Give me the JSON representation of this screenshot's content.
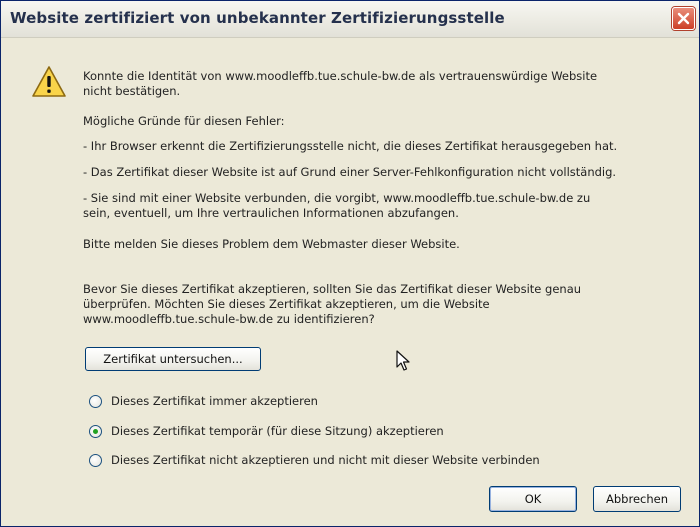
{
  "dialog": {
    "title": "Website zertifiziert von unbekannter Zertifizierungsstelle",
    "message": {
      "intro_line1": "Konnte die Identität von www.moodleffb.tue.schule-bw.de als vertrauenswürdige Website",
      "intro_line2": "nicht bestätigen.",
      "reasons_heading": "Mögliche Gründe für diesen Fehler:",
      "reason1": "- Ihr Browser erkennt die Zertifizierungsstelle nicht, die dieses Zertifikat herausgegeben hat.",
      "reason2": "- Das Zertifikat dieser Website ist auf Grund einer Server-Fehlkonfiguration nicht vollständig.",
      "reason3_line1": "- Sie sind mit einer Website verbunden, die vorgibt, www.moodleffb.tue.schule-bw.de zu",
      "reason3_line2": "sein, eventuell, um Ihre vertraulichen Informationen abzufangen.",
      "notify": "Bitte melden Sie dieses Problem dem Webmaster dieser Website.",
      "question_line1": "Bevor Sie dieses Zertifikat akzeptieren, sollten Sie das Zertifikat dieser Website genau",
      "question_line2": "überprüfen. Möchten Sie dieses Zertifikat akzeptieren, um die Website",
      "question_line3": "www.moodleffb.tue.schule-bw.de zu identifizieren?"
    },
    "examine_button": "Zertifikat untersuchen...",
    "options": [
      {
        "label": "Dieses Zertifikat immer akzeptieren",
        "selected": false
      },
      {
        "label": "Dieses Zertifikat temporär (für diese Sitzung) akzeptieren",
        "selected": true
      },
      {
        "label": "Dieses Zertifikat nicht akzeptieren und nicht mit dieser Website verbinden",
        "selected": false
      }
    ],
    "ok_button": "OK",
    "cancel_button": "Abbrechen"
  },
  "icons": {
    "warning": "warning-icon",
    "close": "close-icon",
    "cursor": "mouse-cursor-icon"
  },
  "colors": {
    "dialog_bg": "#ece9d8",
    "close_red": "#cc3f27",
    "radio_selected": "#21a121"
  }
}
